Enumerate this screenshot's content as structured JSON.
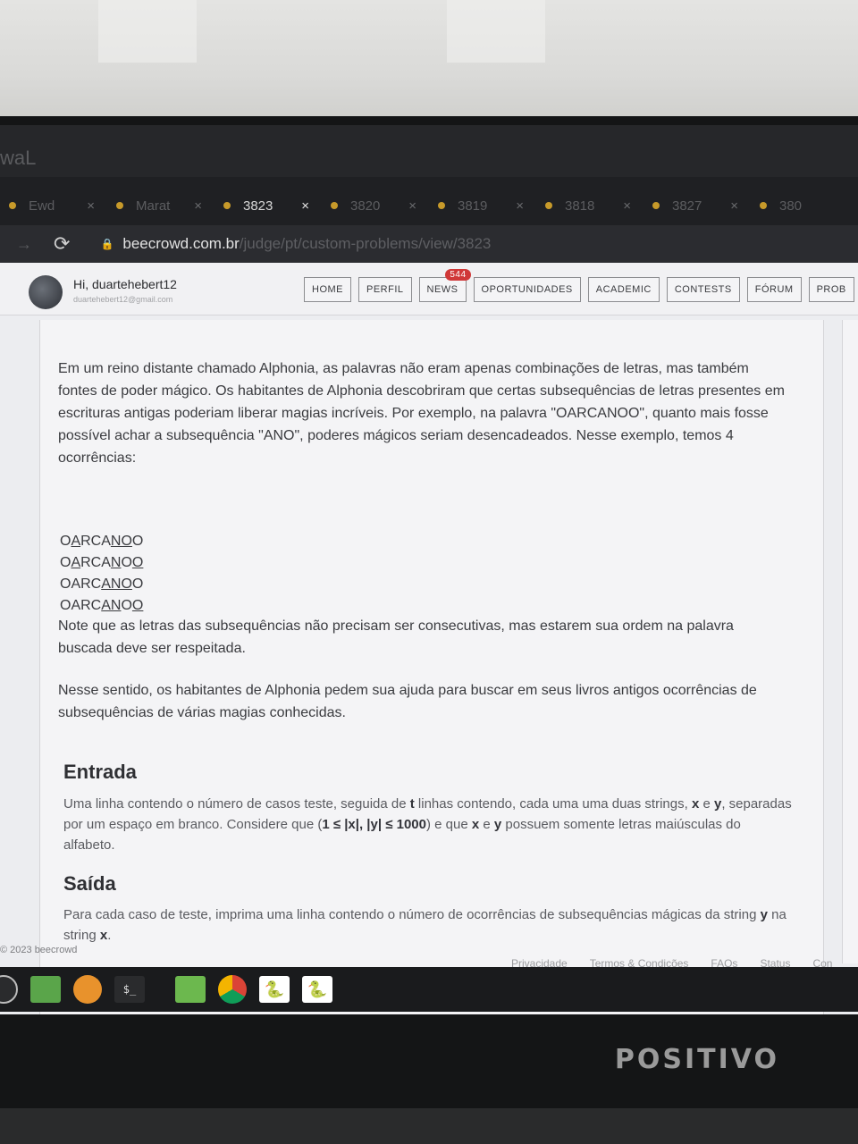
{
  "browser": {
    "window_title": "waL",
    "tabs": [
      {
        "label": "Ewd",
        "active": false
      },
      {
        "label": "Marat",
        "active": false
      },
      {
        "label": "3823",
        "active": true
      },
      {
        "label": "3820",
        "active": false
      },
      {
        "label": "3819",
        "active": false
      },
      {
        "label": "3818",
        "active": false
      },
      {
        "label": "3827",
        "active": false
      },
      {
        "label": "380",
        "active": false
      }
    ],
    "close_symbol": "×",
    "url_host": "beecrowd.com.br",
    "url_path": "/judge/pt/custom-problems/view/3823"
  },
  "header": {
    "greeting": "Hi, duartehebert12",
    "email": "duartehebert12@gmail.com",
    "menu": [
      "HOME",
      "PERFIL",
      "NEWS",
      "OPORTUNIDADES",
      "ACADEMIC",
      "CONTESTS",
      "FÓRUM",
      "PROB"
    ],
    "news_badge": "544"
  },
  "problem": {
    "intro": "Em um reino distante chamado Alphonia, as palavras não eram apenas combinações de letras, mas também fontes de poder mágico. Os habitantes de Alphonia descobriram que certas subsequências de letras presentes em escrituras antigas poderiam liberar magias incríveis. Por exemplo, na palavra \"OARCANOO\", quanto mais fosse possível achar a subsequência \"ANO\", poderes mágicos seriam desencadeados. Nesse exemplo, temos 4 ocorrências:",
    "examples": [
      [
        "O",
        "A",
        "RCA",
        "NO",
        "O"
      ],
      [
        "O",
        "A",
        "RCA",
        "N",
        "O",
        "O",
        ""
      ],
      [
        "OARC",
        "ANO",
        "O"
      ],
      [
        "OARC",
        "AN",
        "O",
        "O",
        ""
      ]
    ],
    "note": "Note que as letras das subsequências não precisam ser consecutivas, mas estarem sua ordem na palavra buscada deve ser respeitada.",
    "request": "Nesse sentido, os habitantes de Alphonia pedem sua ajuda para buscar em seus livros antigos ocorrências de subsequências de várias magias conhecidas.",
    "input_title": "Entrada",
    "input_text": {
      "p1": "Uma linha contendo o número de casos teste, seguida de ",
      "t": "t",
      "p2": " linhas contendo, cada uma uma duas strings, ",
      "x": "x",
      "p3": " e ",
      "y": "y",
      "p4": ", separadas por um espaço em branco. Considere que (",
      "constraint": "1 ≤ |x|, |y| ≤ 1000",
      "p5": ") e que ",
      "x2": "x",
      "p6": " e ",
      "y2": "y",
      "p7": " possuem somente letras maiúsculas do alfabeto."
    },
    "output_title": "Saída",
    "output_text": {
      "p1": "Para cada caso de teste, imprima uma linha contendo o número de ocorrências de subsequências mágicas da string ",
      "y": "y",
      "p2": " na string ",
      "x": "x",
      "p3": "."
    }
  },
  "footer": {
    "copyright": "© 2023 beecrowd",
    "links": [
      "Privacidade",
      "Termos & Condições",
      "FAQs",
      "Status",
      "Con"
    ]
  },
  "taskbar": {
    "terminal_label": "$_"
  },
  "monitor_brand": "POSITIVO"
}
